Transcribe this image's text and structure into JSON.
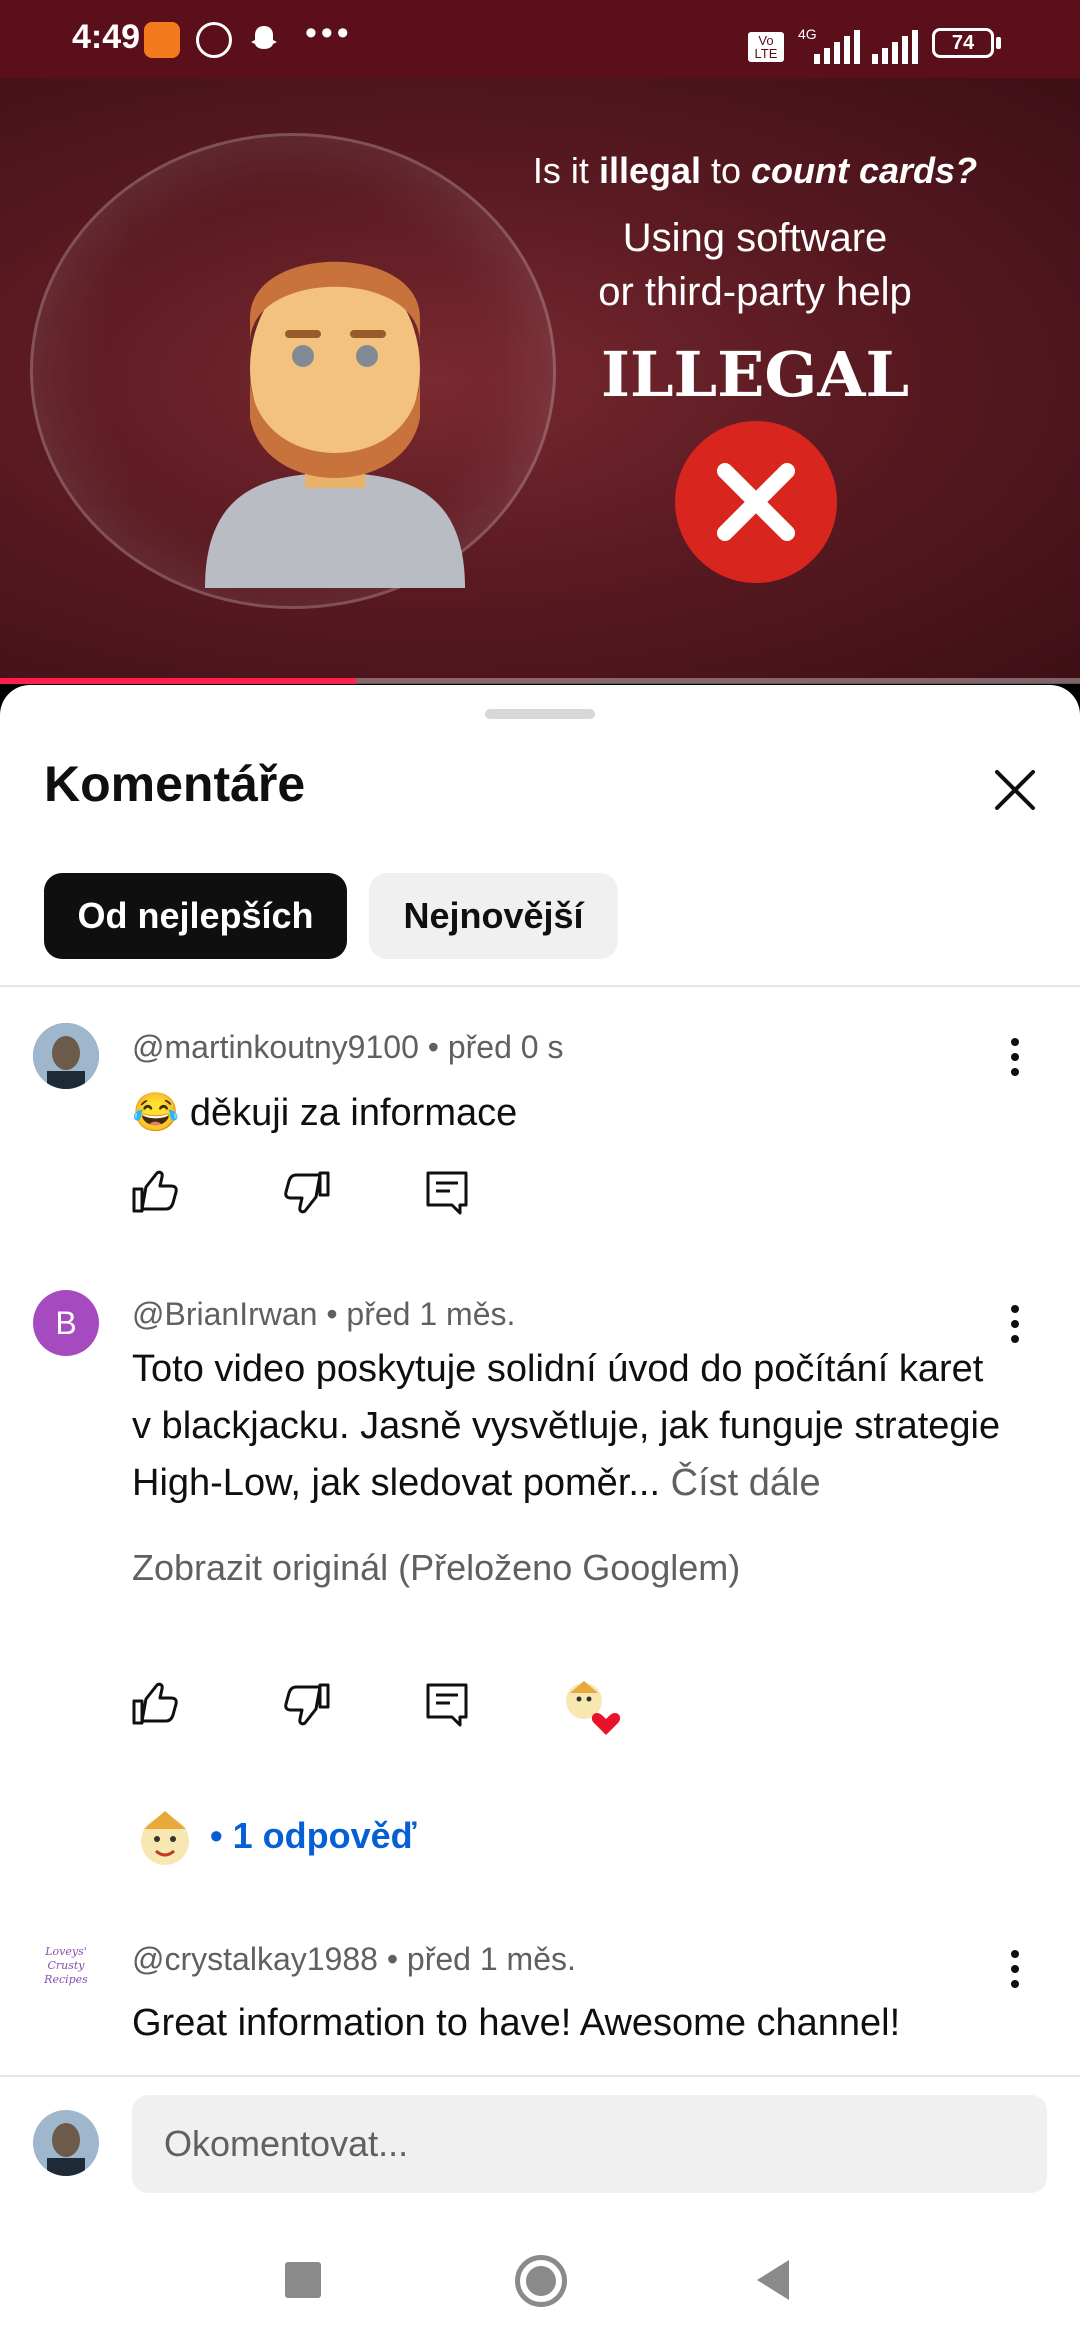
{
  "status_bar": {
    "time": "4:49",
    "volte": "Vo LTE",
    "network": "4G",
    "battery": "74"
  },
  "video": {
    "line1_a": "Is it ",
    "line1_b": "illegal",
    "line1_c": " to ",
    "line1_d": "count cards?",
    "line2": "Using software",
    "line3": "or third-party help",
    "line4": "ILLEGAL",
    "progress": 0.33
  },
  "sheet": {
    "title": "Komentáře",
    "sort_best": "Od nejlepších",
    "sort_newest": "Nejnovější"
  },
  "comments": [
    {
      "author": "@martinkoutny9100",
      "time": "• před 0 s",
      "text": "😂 děkuji za informace"
    },
    {
      "author": "@BrianIrwan",
      "time": "• před 1 měs.",
      "avatar_letter": "B",
      "text": "Toto video poskytuje solidní úvod do počítání karet v blackjacku. Jasně vysvětluje, jak funguje strategie High-Low, jak sledovat poměr...",
      "read_more": " Číst dále",
      "translate": "Zobrazit originál (Přeloženo Googlem)",
      "replies": "• 1 odpověď"
    },
    {
      "author": "@crystalkay1988",
      "time": "• před 1 měs.",
      "avatar_text": "Loveys' Crusty Recipes",
      "text": "Great information to have! Awesome channel!"
    }
  ],
  "composer": {
    "placeholder": "Okomentovat..."
  },
  "colors": {
    "status_bg": "#5a0f1a",
    "progress": "#ff1e50",
    "link": "#065fd4",
    "x_red": "#d8261f"
  }
}
